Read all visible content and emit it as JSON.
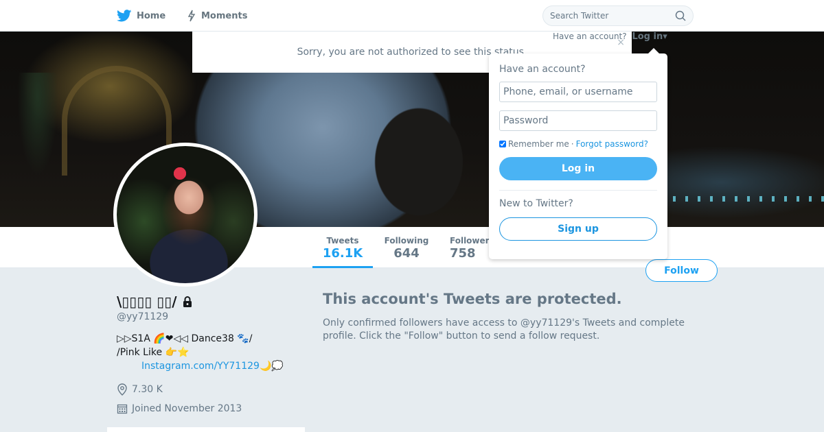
{
  "nav": {
    "home_label": "Home",
    "moments_label": "Moments",
    "search_placeholder": "Search Twitter"
  },
  "alert": {
    "message": "Sorry, you are not authorized to see this status.",
    "close_glyph": "×"
  },
  "login_hint": {
    "prompt": "Have an account?",
    "link_label": "Log in",
    "caret": "▾"
  },
  "login_dropdown": {
    "title": "Have an account?",
    "username_placeholder": "Phone, email, or username",
    "password_placeholder": "Password",
    "remember_label": "Remember me",
    "separator": "·",
    "forgot_label": "Forgot password?",
    "login_button": "Log in",
    "new_prompt": "New to Twitter?",
    "signup_button": "Sign up"
  },
  "stats": {
    "tweets_label": "Tweets",
    "tweets_value": "16.1K",
    "following_label": "Following",
    "following_value": "644",
    "followers_label": "Followers",
    "followers_value": "758"
  },
  "follow_button": "Follow",
  "profile": {
    "name": "\\▯▯▯▯ ▯▯/",
    "handle": "@yy71129",
    "bio_line1": "▷▷S1A 🌈❤◁◁ Dance38 🐾/",
    "bio_line2": "/Pink Like 👉⭐",
    "bio_link": "Instagram.com/YY71129",
    "bio_link_suffix": "🌙💭",
    "location": "7.30 K",
    "joined": "Joined November 2013"
  },
  "protected": {
    "heading": "This account's Tweets are protected.",
    "body": "Only confirmed followers have access to @yy71129's Tweets and complete profile. Click the \"Follow\" button to send a follow request."
  },
  "colors": {
    "accent": "#1da1f2",
    "link": "#1b95e0",
    "login_button": "#4ab3f4",
    "background": "#e6ecf0"
  },
  "icons": [
    "twitter-bird-icon",
    "lightning-icon",
    "search-icon",
    "lock-icon",
    "location-icon",
    "calendar-icon"
  ]
}
